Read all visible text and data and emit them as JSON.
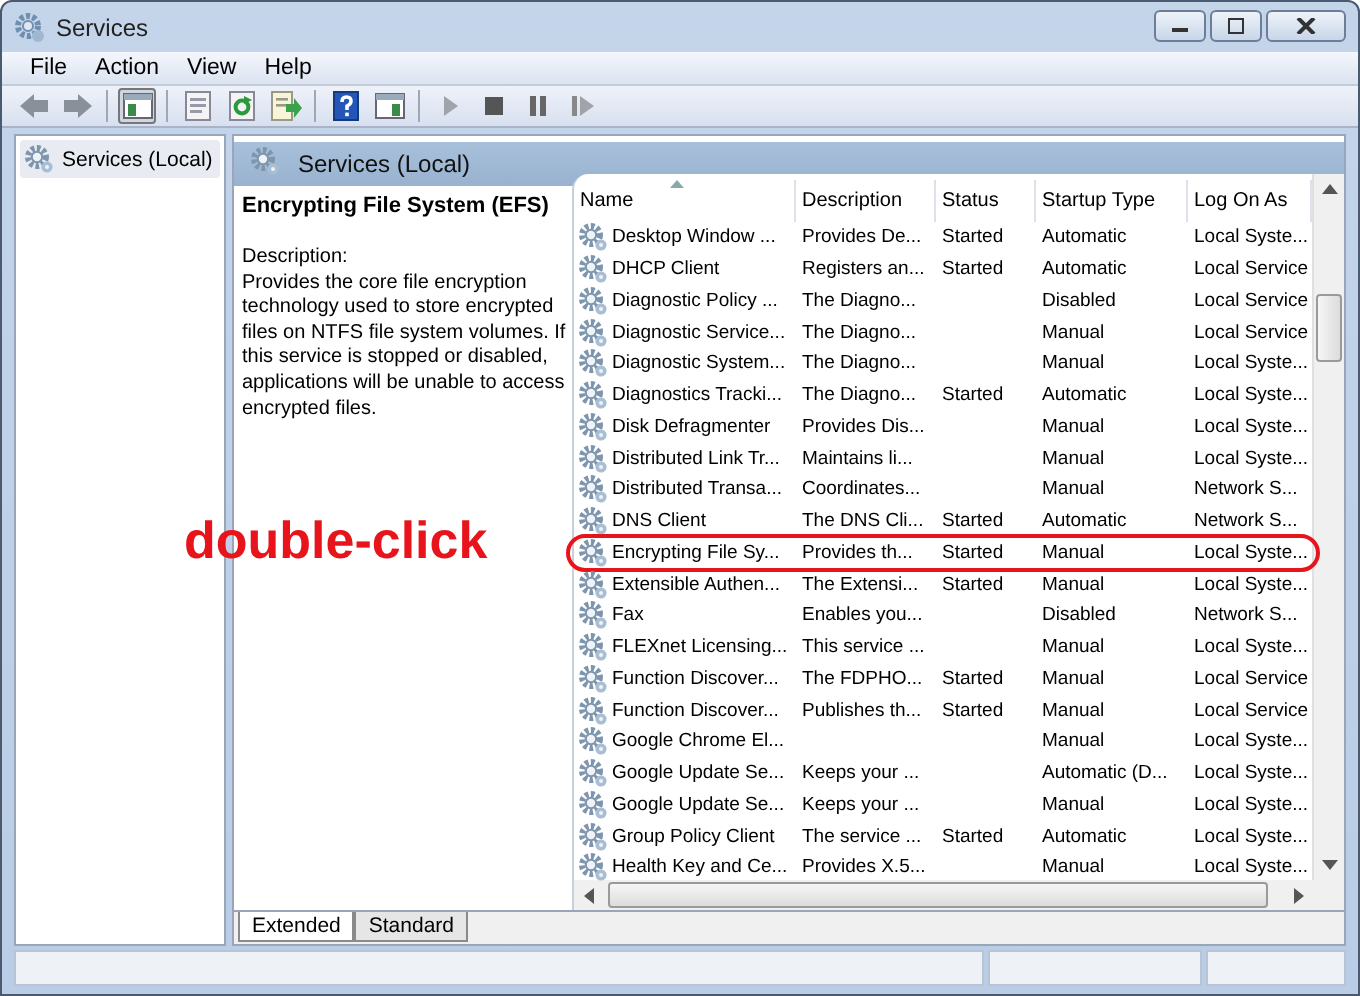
{
  "window": {
    "title": "Services"
  },
  "menu": [
    "File",
    "Action",
    "View",
    "Help"
  ],
  "toolbar": [
    {
      "kind": "back",
      "pressed": false
    },
    {
      "kind": "forward",
      "pressed": false
    },
    {
      "kind": "sep"
    },
    {
      "kind": "tree",
      "pressed": true
    },
    {
      "kind": "sep"
    },
    {
      "kind": "props",
      "pressed": false
    },
    {
      "kind": "refresh",
      "pressed": false
    },
    {
      "kind": "export",
      "pressed": false
    },
    {
      "kind": "sep"
    },
    {
      "kind": "help",
      "pressed": false
    },
    {
      "kind": "pane",
      "pressed": false
    },
    {
      "kind": "sep"
    },
    {
      "kind": "play",
      "pressed": false
    },
    {
      "kind": "stop",
      "pressed": false
    },
    {
      "kind": "pause",
      "pressed": false
    },
    {
      "kind": "resume",
      "pressed": false
    }
  ],
  "tree": {
    "items": [
      {
        "label": "Services (Local)",
        "selected": true
      }
    ]
  },
  "panel": {
    "title": "Services (Local)",
    "details": {
      "name": "Encrypting File System (EFS)",
      "description_label": "Description:",
      "description": "Provides the core file encryption technology used to store encrypted files on NTFS file system volumes. If this service is stopped or disabled, applications will be unable to access encrypted files."
    },
    "columns": [
      {
        "label": "Name",
        "sorted": true
      },
      {
        "label": "Description",
        "sorted": false
      },
      {
        "label": "Status",
        "sorted": false
      },
      {
        "label": "Startup Type",
        "sorted": false
      },
      {
        "label": "Log On As",
        "sorted": false
      }
    ],
    "rows": [
      {
        "cells": [
          "Desktop Window ...",
          "Provides De...",
          "Started",
          "Automatic",
          "Local Syste..."
        ],
        "circled": false
      },
      {
        "cells": [
          "DHCP Client",
          "Registers an...",
          "Started",
          "Automatic",
          "Local Service"
        ],
        "circled": false
      },
      {
        "cells": [
          "Diagnostic Policy ...",
          "The Diagno...",
          "",
          "Disabled",
          "Local Service"
        ],
        "circled": false
      },
      {
        "cells": [
          "Diagnostic Service...",
          "The Diagno...",
          "",
          "Manual",
          "Local Service"
        ],
        "circled": false
      },
      {
        "cells": [
          "Diagnostic System...",
          "The Diagno...",
          "",
          "Manual",
          "Local Syste..."
        ],
        "circled": false
      },
      {
        "cells": [
          "Diagnostics Tracki...",
          "The Diagno...",
          "Started",
          "Automatic",
          "Local Syste..."
        ],
        "circled": false
      },
      {
        "cells": [
          "Disk Defragmenter",
          "Provides Dis...",
          "",
          "Manual",
          "Local Syste..."
        ],
        "circled": false
      },
      {
        "cells": [
          "Distributed Link Tr...",
          "Maintains li...",
          "",
          "Manual",
          "Local Syste..."
        ],
        "circled": false
      },
      {
        "cells": [
          "Distributed Transa...",
          "Coordinates...",
          "",
          "Manual",
          "Network S..."
        ],
        "circled": false
      },
      {
        "cells": [
          "DNS Client",
          "The DNS Cli...",
          "Started",
          "Automatic",
          "Network S..."
        ],
        "circled": false
      },
      {
        "cells": [
          "Encrypting File Sy...",
          "Provides th...",
          "Started",
          "Manual",
          "Local Syste..."
        ],
        "circled": true
      },
      {
        "cells": [
          "Extensible Authen...",
          "The Extensi...",
          "Started",
          "Manual",
          "Local Syste..."
        ],
        "circled": false
      },
      {
        "cells": [
          "Fax",
          "Enables you...",
          "",
          "Disabled",
          "Network S..."
        ],
        "circled": false
      },
      {
        "cells": [
          "FLEXnet Licensing...",
          "This service ...",
          "",
          "Manual",
          "Local Syste..."
        ],
        "circled": false
      },
      {
        "cells": [
          "Function Discover...",
          "The FDPHO...",
          "Started",
          "Manual",
          "Local Service"
        ],
        "circled": false
      },
      {
        "cells": [
          "Function Discover...",
          "Publishes th...",
          "Started",
          "Manual",
          "Local Service"
        ],
        "circled": false
      },
      {
        "cells": [
          "Google Chrome El...",
          "",
          "",
          "Manual",
          "Local Syste..."
        ],
        "circled": false
      },
      {
        "cells": [
          "Google Update Se...",
          "Keeps your ...",
          "",
          "Automatic (D...",
          "Local Syste..."
        ],
        "circled": false
      },
      {
        "cells": [
          "Google Update Se...",
          "Keeps your ...",
          "",
          "Manual",
          "Local Syste..."
        ],
        "circled": false
      },
      {
        "cells": [
          "Group Policy Client",
          "The service ...",
          "Started",
          "Automatic",
          "Local Syste..."
        ],
        "circled": false
      },
      {
        "cells": [
          "Health Key and Ce...",
          "Provides X.5...",
          "",
          "Manual",
          "Local Syste..."
        ],
        "circled": false
      }
    ],
    "tabs": [
      {
        "label": "Extended",
        "selected": true
      },
      {
        "label": "Standard",
        "selected": false
      }
    ]
  },
  "annotation": {
    "text": "double-click"
  }
}
